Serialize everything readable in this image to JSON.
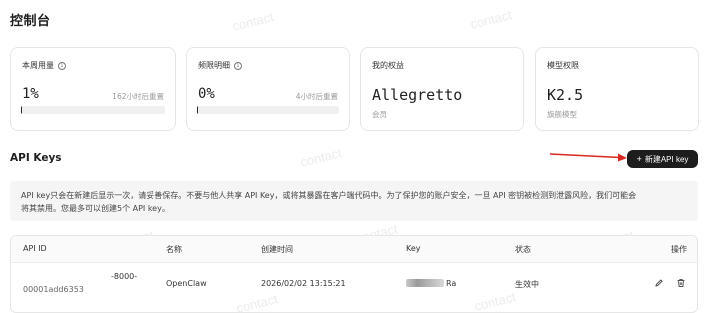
{
  "watermark": "contact",
  "page_title": "控制台",
  "cards": [
    {
      "label": "本周用量",
      "value": "1%",
      "reset_text": "162小时后重置",
      "progress_percent": 1
    },
    {
      "label": "频限明细",
      "value": "0%",
      "reset_text": "4小时后重置",
      "progress_percent": 0
    },
    {
      "label": "我的权益",
      "value": "Allegretto",
      "sub": "会员"
    },
    {
      "label": "模型权限",
      "value": "K2.5",
      "sub": "旗舰模型"
    }
  ],
  "api_keys": {
    "section_title": "API Keys",
    "new_key_button": "新建API key",
    "notice_line1": "API key只会在新建后显示一次，请妥善保存。不要与他人共享 API Key，或将其暴露在客户端代码中。为了保护您的账户安全，一旦 API 密钥被检测到泄露风险，我们可能会",
    "notice_line2": "将其禁用。您最多可以创建5个 API key。",
    "columns": {
      "id": "API ID",
      "name": "名称",
      "created": "创建时间",
      "key": "Key",
      "status": "状态",
      "actions": "操作"
    },
    "rows": [
      {
        "id_part1": "-8000-",
        "id_part2": "00001add6353",
        "name": "OpenClaw",
        "created": "2026/02/02 13:15:21",
        "key_suffix": "Ra",
        "status": "生效中"
      }
    ]
  },
  "colors": {
    "accent_dark": "#1d1d1d",
    "annotation_arrow": "#d8281f"
  },
  "icons": [
    "info-icon",
    "plus-icon",
    "edit-icon",
    "trash-icon"
  ]
}
